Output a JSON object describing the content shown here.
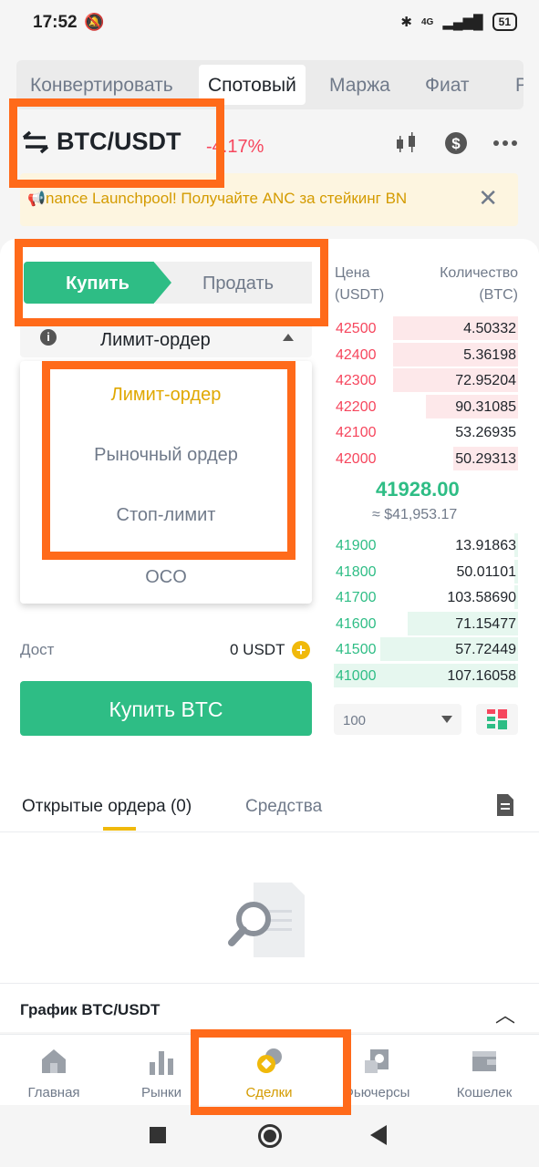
{
  "status": {
    "time": "17:52",
    "network": "4G",
    "battery": "51"
  },
  "tabs": [
    "Конвертировать",
    "Спотовый",
    "Маржа",
    "Фиат",
    "P"
  ],
  "pair": {
    "symbol": "BTC/USDT",
    "change": "-4.17%"
  },
  "banner": {
    "text": "nance Launchpool! Получайте ANC за стейкинг BN"
  },
  "trade": {
    "buy_label": "Купить",
    "sell_label": "Продать",
    "order_type": "Лимит-ордер",
    "dropdown": [
      "Лимит-ордер",
      "Рыночный ордер",
      "Стоп-лимит",
      "OCO"
    ],
    "available_label": "Дост",
    "available_value": "0 USDT",
    "submit_label": "Купить BTC"
  },
  "orderbook": {
    "price_header": "Цена\n(USDT)",
    "qty_header": "Количество\n(BTC)",
    "asks": [
      {
        "price": "42500",
        "qty": "4.50332",
        "depth": 0.68
      },
      {
        "price": "42400",
        "qty": "5.36198",
        "depth": 0.68
      },
      {
        "price": "42300",
        "qty": "72.95204",
        "depth": 0.68
      },
      {
        "price": "42200",
        "qty": "90.31085",
        "depth": 0.5
      },
      {
        "price": "42100",
        "qty": "53.26935",
        "depth": 0.0
      },
      {
        "price": "42000",
        "qty": "50.29313",
        "depth": 0.35
      }
    ],
    "mid_price": "41928.00",
    "mid_usd": "≈ $41,953.17",
    "bids": [
      {
        "price": "41900",
        "qty": "13.91863",
        "depth": 0.02
      },
      {
        "price": "41800",
        "qty": "50.01101",
        "depth": 0.02
      },
      {
        "price": "41700",
        "qty": "103.58690",
        "depth": 0.02
      },
      {
        "price": "41600",
        "qty": "71.15477",
        "depth": 0.6
      },
      {
        "price": "41500",
        "qty": "57.72449",
        "depth": 0.75
      },
      {
        "price": "41000",
        "qty": "107.16058",
        "depth": 1.0
      }
    ],
    "depth_value": "100"
  },
  "orders": {
    "open_tab": "Открытые ордера (0)",
    "funds_tab": "Средства"
  },
  "chart_row": "График BTC/USDT",
  "nav": [
    "Главная",
    "Рынки",
    "Сделки",
    "Фьючерсы",
    "Кошелек"
  ],
  "colors": {
    "green": "#2ebd85",
    "red": "#f6465d",
    "yellow": "#f0b90b",
    "highlight": "#ff6a1a"
  }
}
